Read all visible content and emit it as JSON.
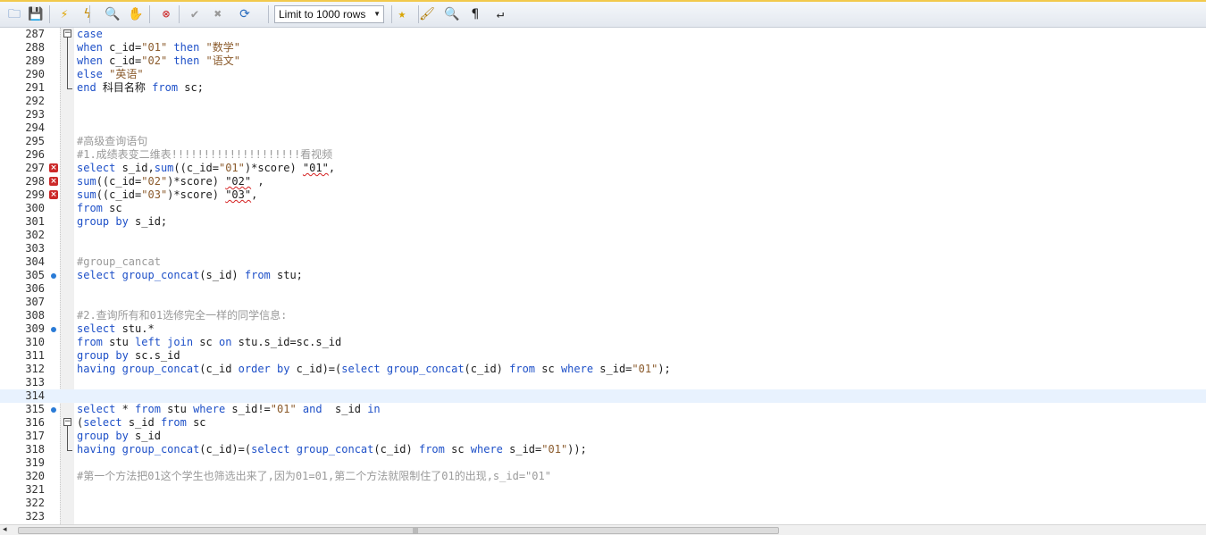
{
  "toolbar": {
    "left_buttons": [
      {
        "icon": "open-folder-icon",
        "glyph": "🗀",
        "color": "#3b6fb6"
      },
      {
        "icon": "save-icon",
        "glyph": "💾",
        "color": "#2d5aa0"
      },
      {
        "icon": "execute-lightning-icon",
        "glyph": "⚡",
        "color": "#e0a500"
      },
      {
        "icon": "execute-current-icon",
        "glyph": "ϟ",
        "color": "#c58a00"
      },
      {
        "icon": "explain-magnifier-icon",
        "glyph": "🔍",
        "color": "#556"
      },
      {
        "icon": "stop-icon",
        "glyph": "✋",
        "color": "#999"
      },
      {
        "icon": "toggle-continue-icon",
        "glyph": "⊗",
        "color": "#c22"
      },
      {
        "icon": "commit-icon",
        "glyph": "✔",
        "color": "#999"
      },
      {
        "icon": "rollback-icon",
        "glyph": "✖",
        "color": "#999"
      },
      {
        "icon": "autocommit-icon",
        "glyph": "⟳",
        "color": "#2d6fbf"
      }
    ],
    "limit_select": {
      "selected": "Limit to 1000 rows"
    },
    "right_buttons": [
      {
        "icon": "add-snippet-icon",
        "glyph": "★",
        "color": "#d8a400"
      },
      {
        "icon": "beautify-icon",
        "glyph": "🖌",
        "color": "#b07a00"
      },
      {
        "icon": "find-icon",
        "glyph": "🔍",
        "color": "#445"
      },
      {
        "icon": "invisible-chars-icon",
        "glyph": "¶",
        "color": "#222"
      },
      {
        "icon": "wrap-lines-icon",
        "glyph": "↵",
        "color": "#222"
      }
    ]
  },
  "editor": {
    "current_line": 314,
    "lines": [
      {
        "n": 287,
        "fold": "open",
        "tokens": [
          [
            "kw",
            "case"
          ]
        ]
      },
      {
        "n": 288,
        "fold": "mid",
        "tokens": [
          [
            "kw",
            "when"
          ],
          [
            "t",
            " c_id="
          ],
          [
            "str",
            "\"01\""
          ],
          [
            "t",
            " "
          ],
          [
            "kw",
            "then"
          ],
          [
            "t",
            " "
          ],
          [
            "str",
            "\"数学\""
          ]
        ]
      },
      {
        "n": 289,
        "fold": "mid",
        "tokens": [
          [
            "kw",
            "when"
          ],
          [
            "t",
            " c_id="
          ],
          [
            "str",
            "\"02\""
          ],
          [
            "t",
            " "
          ],
          [
            "kw",
            "then"
          ],
          [
            "t",
            " "
          ],
          [
            "str",
            "\"语文\""
          ]
        ]
      },
      {
        "n": 290,
        "fold": "mid",
        "tokens": [
          [
            "kw",
            "else"
          ],
          [
            "t",
            " "
          ],
          [
            "str",
            "\"英语\""
          ]
        ]
      },
      {
        "n": 291,
        "fold": "end",
        "tokens": [
          [
            "kw",
            "end"
          ],
          [
            "t",
            " 科目名称 "
          ],
          [
            "kw",
            "from"
          ],
          [
            "t",
            " sc;"
          ]
        ]
      },
      {
        "n": 292,
        "tokens": []
      },
      {
        "n": 293,
        "tokens": []
      },
      {
        "n": 294,
        "tokens": []
      },
      {
        "n": 295,
        "tokens": [
          [
            "cm",
            "#高级查询语句"
          ]
        ]
      },
      {
        "n": 296,
        "tokens": [
          [
            "cm",
            "#1.成绩表变二维表!!!!!!!!!!!!!!!!!!!!看视频"
          ]
        ]
      },
      {
        "n": 297,
        "marker": "error",
        "tokens": [
          [
            "kw",
            "select"
          ],
          [
            "t",
            " s_id,"
          ],
          [
            "kw",
            "sum"
          ],
          [
            "t",
            "((c_id="
          ],
          [
            "str",
            "\"01\""
          ],
          [
            "t",
            ")*score) "
          ],
          [
            "sq",
            "\"01\""
          ],
          [
            "t",
            ","
          ]
        ]
      },
      {
        "n": 298,
        "marker": "error",
        "tokens": [
          [
            "kw",
            "sum"
          ],
          [
            "t",
            "((c_id="
          ],
          [
            "str",
            "\"02\""
          ],
          [
            "t",
            ")*score) "
          ],
          [
            "sq",
            "\"02\""
          ],
          [
            "t",
            " ,"
          ]
        ]
      },
      {
        "n": 299,
        "marker": "error",
        "tokens": [
          [
            "kw",
            "sum"
          ],
          [
            "t",
            "((c_id="
          ],
          [
            "str",
            "\"03\""
          ],
          [
            "t",
            ")*score) "
          ],
          [
            "sq",
            "\"03\""
          ],
          [
            "t",
            ","
          ]
        ]
      },
      {
        "n": 300,
        "tokens": [
          [
            "kw",
            "from"
          ],
          [
            "t",
            " sc"
          ]
        ]
      },
      {
        "n": 301,
        "tokens": [
          [
            "kw",
            "group by"
          ],
          [
            "t",
            " s_id;"
          ]
        ]
      },
      {
        "n": 302,
        "tokens": []
      },
      {
        "n": 303,
        "tokens": []
      },
      {
        "n": 304,
        "tokens": [
          [
            "cm",
            "#group_cancat"
          ]
        ]
      },
      {
        "n": 305,
        "marker": "dot",
        "tokens": [
          [
            "kw",
            "select"
          ],
          [
            "t",
            " "
          ],
          [
            "kw",
            "group_concat"
          ],
          [
            "t",
            "(s_id) "
          ],
          [
            "kw",
            "from"
          ],
          [
            "t",
            " stu;"
          ]
        ]
      },
      {
        "n": 306,
        "tokens": []
      },
      {
        "n": 307,
        "tokens": []
      },
      {
        "n": 308,
        "tokens": [
          [
            "cm",
            "#2.查询所有和01选修完全一样的同学信息:"
          ]
        ]
      },
      {
        "n": 309,
        "marker": "dot",
        "tokens": [
          [
            "kw",
            "select"
          ],
          [
            "t",
            " stu.*"
          ]
        ]
      },
      {
        "n": 310,
        "tokens": [
          [
            "kw",
            "from"
          ],
          [
            "t",
            " stu "
          ],
          [
            "kw",
            "left join"
          ],
          [
            "t",
            " sc "
          ],
          [
            "kw",
            "on"
          ],
          [
            "t",
            " stu.s_id=sc.s_id"
          ]
        ]
      },
      {
        "n": 311,
        "tokens": [
          [
            "kw",
            "group by"
          ],
          [
            "t",
            " sc.s_id"
          ]
        ]
      },
      {
        "n": 312,
        "tokens": [
          [
            "kw",
            "having"
          ],
          [
            "t",
            " "
          ],
          [
            "kw",
            "group_concat"
          ],
          [
            "t",
            "(c_id "
          ],
          [
            "kw",
            "order by"
          ],
          [
            "t",
            " c_id)=("
          ],
          [
            "kw",
            "select"
          ],
          [
            "t",
            " "
          ],
          [
            "kw",
            "group_concat"
          ],
          [
            "t",
            "(c_id) "
          ],
          [
            "kw",
            "from"
          ],
          [
            "t",
            " sc "
          ],
          [
            "kw",
            "where"
          ],
          [
            "t",
            " s_id="
          ],
          [
            "str",
            "\"01\""
          ],
          [
            "t",
            ");"
          ]
        ]
      },
      {
        "n": 313,
        "tokens": []
      },
      {
        "n": 314,
        "tokens": []
      },
      {
        "n": 315,
        "marker": "dot",
        "tokens": [
          [
            "kw",
            "select"
          ],
          [
            "t",
            " * "
          ],
          [
            "kw",
            "from"
          ],
          [
            "t",
            " stu "
          ],
          [
            "kw",
            "where"
          ],
          [
            "t",
            " s_id!="
          ],
          [
            "str",
            "\"01\""
          ],
          [
            "t",
            " "
          ],
          [
            "kw",
            "and"
          ],
          [
            "t",
            "  s_id "
          ],
          [
            "kw",
            "in"
          ]
        ]
      },
      {
        "n": 316,
        "fold": "open",
        "tokens": [
          [
            "t",
            "("
          ],
          [
            "kw",
            "select"
          ],
          [
            "t",
            " s_id "
          ],
          [
            "kw",
            "from"
          ],
          [
            "t",
            " sc"
          ]
        ]
      },
      {
        "n": 317,
        "fold": "mid",
        "tokens": [
          [
            "kw",
            "group by"
          ],
          [
            "t",
            " s_id"
          ]
        ]
      },
      {
        "n": 318,
        "fold": "end",
        "tokens": [
          [
            "kw",
            "having"
          ],
          [
            "t",
            " "
          ],
          [
            "kw",
            "group_concat"
          ],
          [
            "t",
            "(c_id)=("
          ],
          [
            "kw",
            "select"
          ],
          [
            "t",
            " "
          ],
          [
            "kw",
            "group_concat"
          ],
          [
            "t",
            "(c_id) "
          ],
          [
            "kw",
            "from"
          ],
          [
            "t",
            " sc "
          ],
          [
            "kw",
            "where"
          ],
          [
            "t",
            " s_id="
          ],
          [
            "str",
            "\"01\""
          ],
          [
            "t",
            "));"
          ]
        ]
      },
      {
        "n": 319,
        "tokens": []
      },
      {
        "n": 320,
        "tokens": [
          [
            "cm",
            "#第一个方法把01这个学生也筛选出来了,因为01=01,第二个方法就限制住了01的出现,s_id=\"01\""
          ]
        ]
      },
      {
        "n": 321,
        "tokens": []
      },
      {
        "n": 322,
        "tokens": []
      },
      {
        "n": 323,
        "tokens": []
      }
    ]
  },
  "scrollbar": {
    "left_arrow": "◂",
    "grip": "|||"
  }
}
